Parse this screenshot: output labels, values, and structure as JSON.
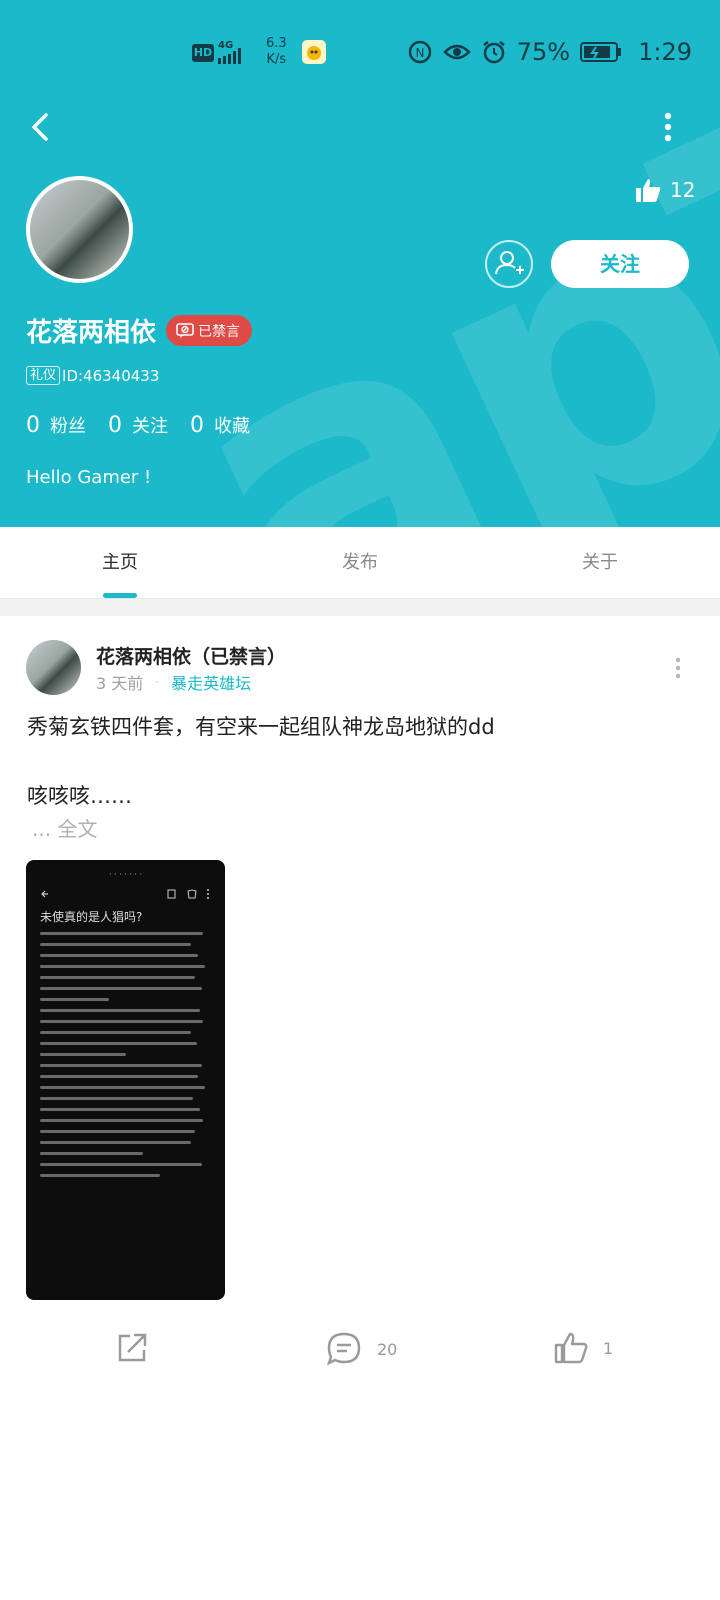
{
  "status_bar": {
    "hd": "HD",
    "network": "4G",
    "speed": "6.3",
    "speed_unit": "K/s",
    "battery_pct": "75%",
    "time": "1:29"
  },
  "profile": {
    "like_count": "12",
    "follow_label": "关注",
    "name": "花落两相依",
    "banned_label": "已禁言",
    "liyi_badge": "礼仪",
    "id_text": "ID:46340433",
    "stats": [
      {
        "num": "0",
        "label": "粉丝"
      },
      {
        "num": "0",
        "label": "关注"
      },
      {
        "num": "0",
        "label": "收藏"
      }
    ],
    "bio": "Hello Gamer !"
  },
  "tabs": [
    {
      "label": "主页",
      "active": true
    },
    {
      "label": "发布",
      "active": false
    },
    {
      "label": "关于",
      "active": false
    }
  ],
  "post": {
    "author": "花落两相依（已禁言）",
    "time": "3 天前",
    "forum": "暴走英雄坛",
    "text_line1": "秀菊玄铁四件套，有空来一起组队神龙岛地狱的dd",
    "text_line2": "咳咳咳……",
    "full_text_label": "... 全文",
    "image_title": "未使真的是人猖吗?",
    "comment_count": "20",
    "like_count": "1"
  },
  "colors": {
    "accent": "#1bb9c9",
    "banned": "#e04a45"
  }
}
